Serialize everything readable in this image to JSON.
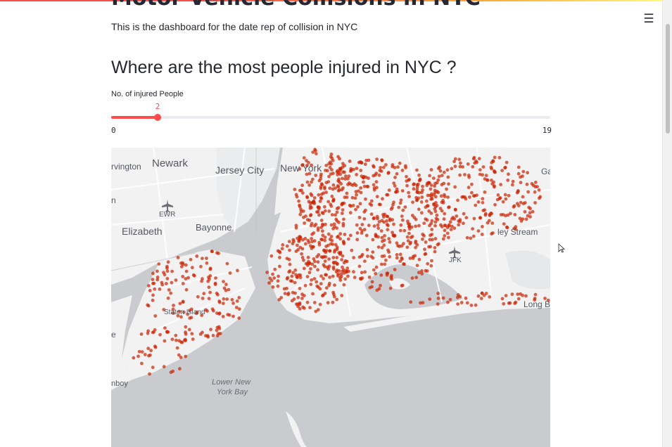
{
  "header": {
    "menu_icon": "hamburger-menu-icon"
  },
  "page": {
    "title": "Motor Vehicle Collisions in NYC",
    "subtitle": "This is the dashboard for the date rep of collision in NYC",
    "section_heading": "Where are the most people injured in NYC ?"
  },
  "slider": {
    "label": "No. of injured People",
    "value": 2,
    "value_text": "2",
    "min": 0,
    "min_text": "0",
    "max": 19,
    "max_text": "19",
    "accent_color": "#ff4b4b"
  },
  "map": {
    "labels": {
      "irvington": "rvington",
      "newark": "Newark",
      "jersey_city": "Jersey City",
      "new_york": "New York",
      "ga": "Ga",
      "n": "n",
      "ewr": "EWR",
      "elizabeth": "Elizabeth",
      "bayonne": "Bayonne",
      "valley_stream": "ley Stream",
      "jfk": "JFK",
      "staten_island": "Staten Island",
      "long_beach": "Long B",
      "e": "e",
      "lower_ny_bay_1": "Lower New",
      "lower_ny_bay_2": "York Bay",
      "bay": "nboy"
    },
    "land_color": "#f2f2f2",
    "water_color": "#c9cbcf",
    "point_color": "#cc2200"
  }
}
